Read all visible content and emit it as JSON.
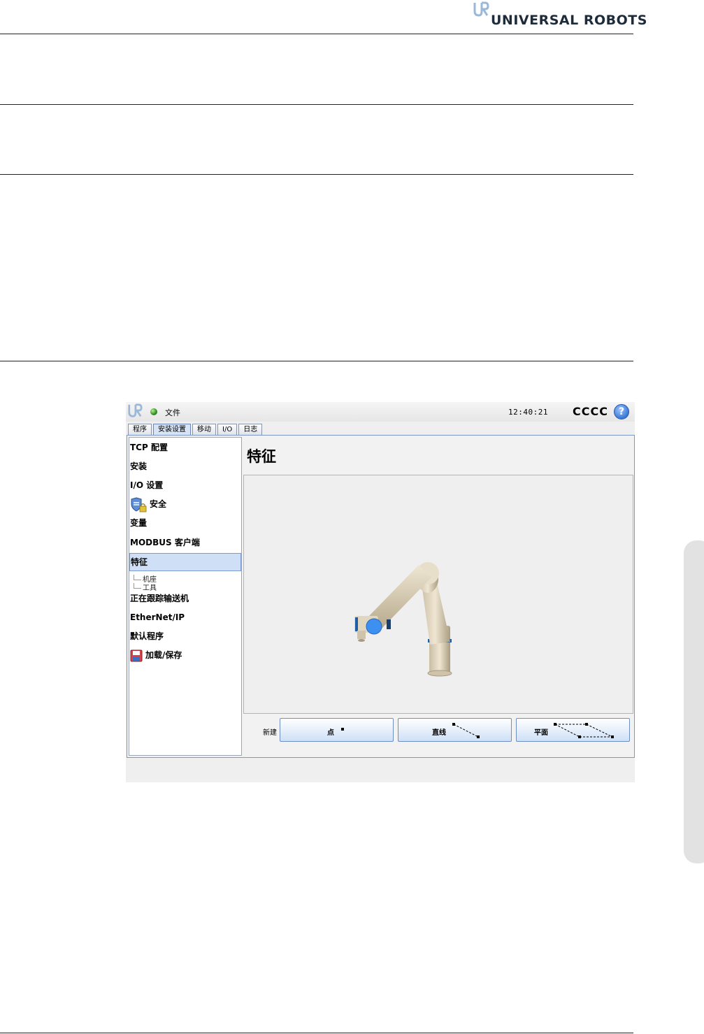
{
  "header": {
    "brand": "UNIVERSAL ROBOTS"
  },
  "app": {
    "file_menu": "文件",
    "time": "12:40:21",
    "robot_name": "CCCC",
    "help_label": "?",
    "tabs": [
      {
        "label": "程序"
      },
      {
        "label": "安装设置",
        "active": true
      },
      {
        "label": "移动"
      },
      {
        "label": "I/O"
      },
      {
        "label": "日志"
      }
    ],
    "sidebar": {
      "items": [
        {
          "label": "TCP 配置"
        },
        {
          "label": "安装"
        },
        {
          "label": "I/O 设置"
        },
        {
          "label": "安全",
          "icon": "shield-lock-icon"
        },
        {
          "label": "变量"
        },
        {
          "label": "MODBUS 客户端"
        },
        {
          "label": "特征",
          "selected": true
        },
        {
          "label": "正在跟踪输送机"
        },
        {
          "label": "EtherNet/IP"
        },
        {
          "label": "默认程序"
        },
        {
          "label": "加载/保存",
          "icon": "floppy-disk-icon"
        }
      ],
      "sub_items": [
        {
          "label": "机座"
        },
        {
          "label": "工具"
        }
      ]
    },
    "main": {
      "title": "特征",
      "new_label": "新建",
      "buttons": [
        {
          "label": "点",
          "icon": "point-icon"
        },
        {
          "label": "直线",
          "icon": "line-icon"
        },
        {
          "label": "平面",
          "icon": "plane-icon"
        }
      ]
    }
  },
  "colors": {
    "accent": "#7a9ad0",
    "selected_bg": "#cfdff5",
    "robot_joint_blue": "#1f5fa8"
  }
}
